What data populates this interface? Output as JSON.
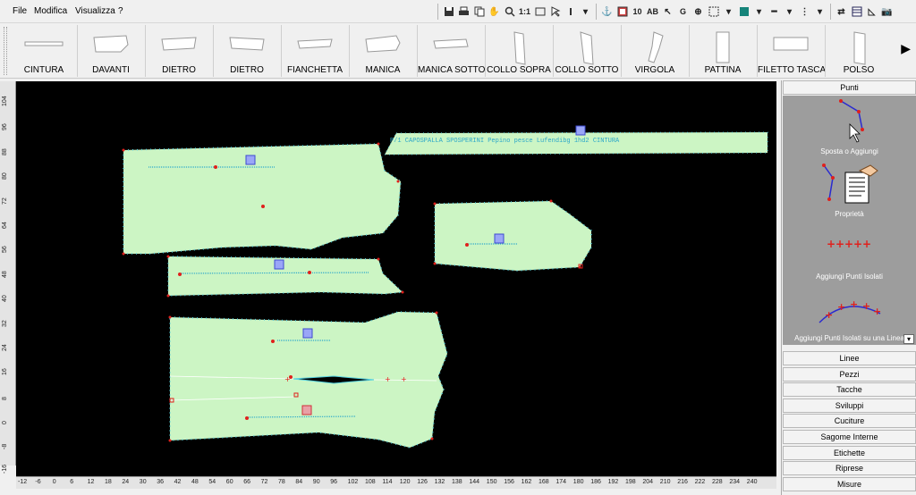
{
  "menubar": {
    "items": [
      "File",
      "Modifica",
      "Visualizza",
      "?"
    ]
  },
  "toolbar": {
    "scale_label": "1:1",
    "grid_size": "10",
    "ab_label": "AB",
    "g_label": "G"
  },
  "pieces": [
    {
      "label": "CINTURA",
      "icon": "belt-piece-icon"
    },
    {
      "label": "DAVANTI",
      "icon": "front-piece-icon"
    },
    {
      "label": "DIETRO",
      "icon": "back-piece-icon"
    },
    {
      "label": "DIETRO",
      "icon": "back-piece-icon"
    },
    {
      "label": "FIANCHETTA",
      "icon": "side-piece-icon"
    },
    {
      "label": "MANICA",
      "icon": "sleeve-piece-icon"
    },
    {
      "label": "MANICA SOTTO",
      "icon": "under-sleeve-piece-icon"
    },
    {
      "label": "COLLO SOPRA",
      "icon": "top-collar-piece-icon"
    },
    {
      "label": "COLLO SOTTO",
      "icon": "under-collar-piece-icon"
    },
    {
      "label": "VIRGOLA",
      "icon": "virgola-piece-icon"
    },
    {
      "label": "PATTINA",
      "icon": "flap-piece-icon"
    },
    {
      "label": "FILETTO TASCA",
      "icon": "pocket-welt-piece-icon"
    },
    {
      "label": "POLSO",
      "icon": "cuff-piece-icon"
    }
  ],
  "ruler_left": [
    "104",
    "96",
    "88",
    "80",
    "72",
    "64",
    "56",
    "48",
    "40",
    "32",
    "24",
    "16",
    "8",
    "0",
    "-8",
    "-16"
  ],
  "ruler_bottom": [
    "-12",
    "-6",
    "0",
    "6",
    "12",
    "18",
    "24",
    "30",
    "36",
    "42",
    "48",
    "54",
    "60",
    "66",
    "72",
    "78",
    "84",
    "90",
    "96",
    "102",
    "108",
    "114",
    "120",
    "126",
    "132",
    "138",
    "144",
    "150",
    "156",
    "162",
    "168",
    "174",
    "180",
    "186",
    "192",
    "198",
    "204",
    "210",
    "216",
    "222",
    "228",
    "234",
    "240"
  ],
  "canvas_labels": {
    "belt_text": "P/1 CAPOSPALLA SPOSPERINI Pepino pesce Lufendibg 1hd2 CINTURA"
  },
  "right_panel": {
    "header": "Punti",
    "actions": [
      {
        "label": "Sposta o Aggiungi"
      },
      {
        "label": "Proprietà"
      },
      {
        "label": "Aggiungi Punti Isolati"
      },
      {
        "label": "Aggiungi Punti Isolati su una Linea"
      }
    ],
    "sections": [
      "Linee",
      "Pezzi",
      "Tacche",
      "Sviluppi",
      "Cuciture",
      "Sagome Interne",
      "Etichette",
      "Riprese",
      "Misure"
    ]
  },
  "colors": {
    "piece_fill": "#ccf5c4",
    "piece_outline": "#53d1e0",
    "point_red": "#e0201c",
    "canvas_bg": "#000000"
  }
}
